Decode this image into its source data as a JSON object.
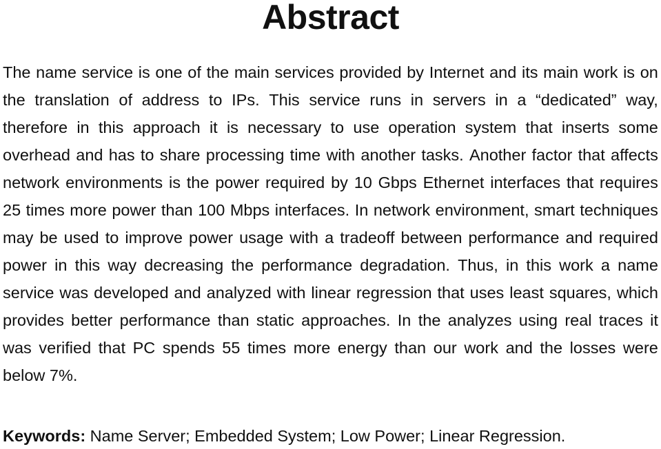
{
  "document": {
    "heading": "Abstract",
    "abstract_lines": [
      "The name service is one of the main services provided by Internet and its main work is on",
      "the translation of address to IPs. This service runs in servers in a “dedicated” way,",
      "therefore in this approach it is necessary to use operation system that inserts some",
      "overhead and has to share processing time with another tasks. Another factor that affects",
      "network environments is the power required by 10 Gbps Ethernet interfaces that requires",
      "25 times more power than 100 Mbps interfaces. In network environment, smart techniques",
      "may be used to improve power usage with a tradeoff between performance and required",
      "power in this way decreasing the performance degradation. Thus, in this work a name",
      "service was developed and analyzed with linear regression that uses least squares, which",
      "provides better performance than static approaches. In the analyzes using real traces it",
      "was verified that PC spends 55 times more energy than our work and the losses were",
      "below 7%."
    ],
    "abstract_text": "The name service is one of the main services provided by Internet and its main work is on the translation of address to IPs. This service runs in servers in a “dedicated” way, therefore in this approach it is necessary to use operation system that inserts some overhead and has to share processing time with another tasks. Another factor that affects network environments is the power required by 10 Gbps Ethernet interfaces that requires 25 times more power than 100 Mbps interfaces. In network environment, smart techniques may be used to improve power usage with a tradeoff between performance and required power in this way decreasing the performance degradation. Thus, in this work a name service was developed and analyzed with linear regression that uses least squares, which provides better performance than static approaches. In the analyzes using real traces it was verified that PC spends 55 times more energy than our work and the losses were below 7%.",
    "keywords_label": "Keywords:",
    "keywords_values": "Name Server; Embedded System; Low Power; Linear Regression."
  }
}
